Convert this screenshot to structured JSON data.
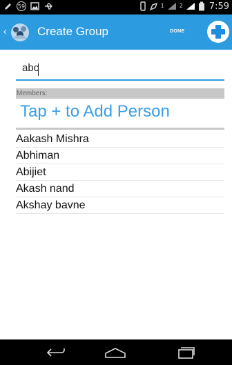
{
  "status_bar": {
    "notification_badge": "59",
    "time": "7:59",
    "signal_1_label": "1",
    "signal_2_label": "2",
    "icons": [
      "pencil-icon",
      "notification-59-icon",
      "image-icon",
      "usb-icon",
      "vibrate-icon",
      "alarm-icon",
      "signal-icon",
      "signal-icon",
      "battery-icon"
    ]
  },
  "action_bar": {
    "title": "Create Group",
    "done_label": "DONE",
    "accent_color": "#2c9be0"
  },
  "group_name": {
    "value": "abc"
  },
  "members": {
    "header": "Members:",
    "add_prompt": "Tap + to Add Person",
    "list": [
      "Aakash Mishra",
      "Abhiman",
      "Abijiet",
      "Akash nand",
      "Akshay bavne"
    ]
  },
  "navigation": {
    "icons": [
      "back-icon",
      "home-icon",
      "recents-icon"
    ]
  }
}
